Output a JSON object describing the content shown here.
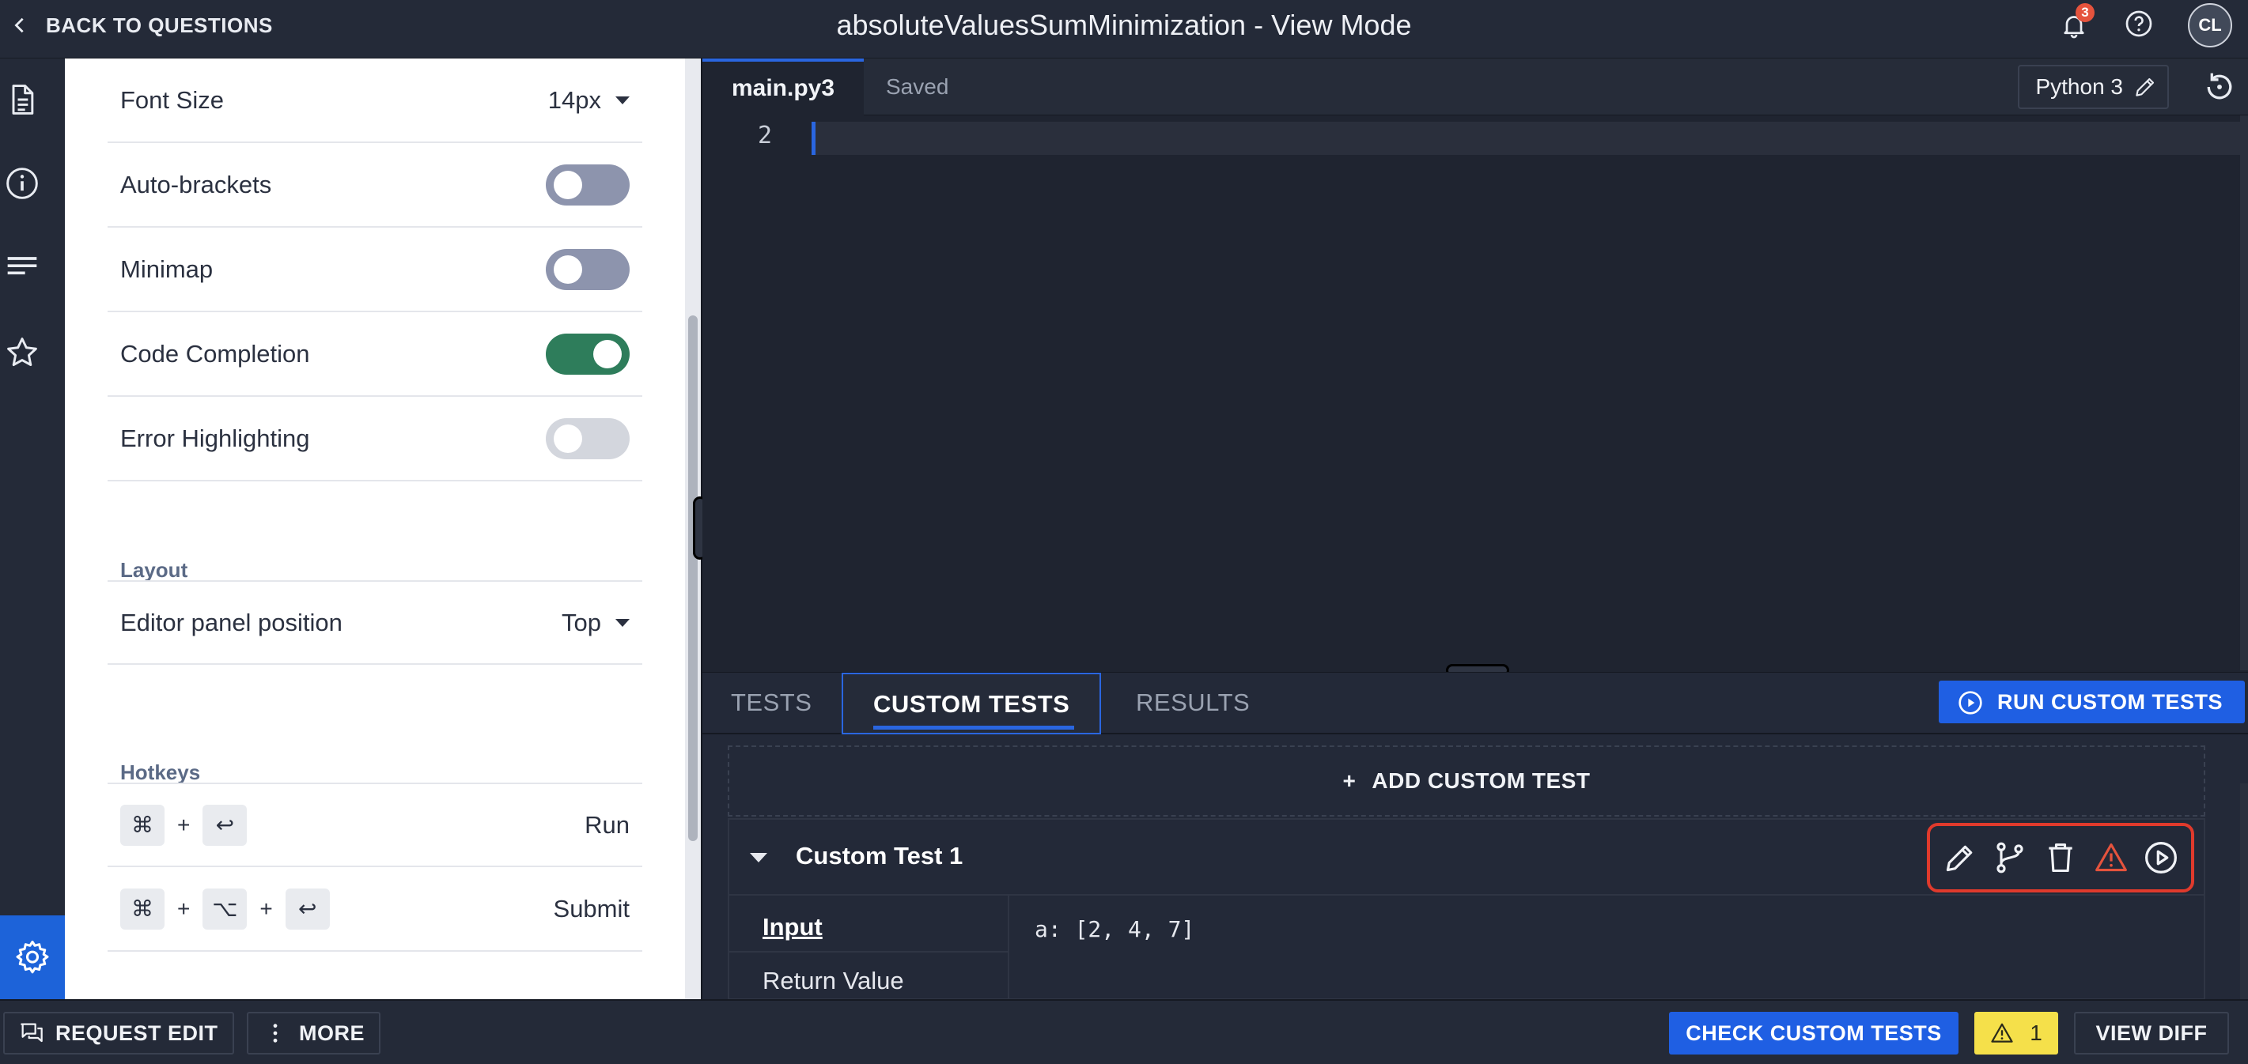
{
  "header": {
    "back_label": "BACK TO QUESTIONS",
    "title": "absoluteValuesSumMinimization - View Mode",
    "notification_count": "3",
    "avatar_initials": "CL"
  },
  "settings": {
    "font_size_label": "Font Size",
    "font_size_value": "14px",
    "toggles": [
      {
        "label": "Auto-brackets",
        "state": "off"
      },
      {
        "label": "Minimap",
        "state": "off"
      },
      {
        "label": "Code Completion",
        "state": "on"
      },
      {
        "label": "Error Highlighting",
        "state": "disabled"
      }
    ],
    "layout_heading": "Layout",
    "editor_panel_label": "Editor panel position",
    "editor_panel_value": "Top",
    "hotkeys_heading": "Hotkeys",
    "hotkeys": [
      {
        "keys": [
          "⌘",
          "↩"
        ],
        "action": "Run"
      },
      {
        "keys": [
          "⌘",
          "⌥",
          "↩"
        ],
        "action": "Submit"
      }
    ],
    "plus": "+"
  },
  "editor": {
    "file_tab": "main.py3",
    "saved_status": "Saved",
    "language": "Python 3",
    "line_number": "2"
  },
  "tests_panel": {
    "tabs": [
      "TESTS",
      "CUSTOM TESTS",
      "RESULTS"
    ],
    "active_tab": "CUSTOM TESTS",
    "run_button": "RUN CUSTOM TESTS",
    "add_button": "ADD CUSTOM TEST",
    "add_plus": "+",
    "test_name": "Custom Test 1",
    "input_label": "Input",
    "input_value": "a: [2, 4, 7]",
    "return_label": "Return Value"
  },
  "footer": {
    "request_edit": "REQUEST EDIT",
    "more": "MORE",
    "check_button": "CHECK CUSTOM TESTS",
    "warning_count": "1",
    "view_diff": "VIEW DIFF"
  },
  "colors": {
    "accent_blue": "#1f5fe3",
    "toggle_on": "#2e7d5b",
    "warning_yellow": "#f5e04a",
    "highlight_red": "#e03a2c"
  }
}
